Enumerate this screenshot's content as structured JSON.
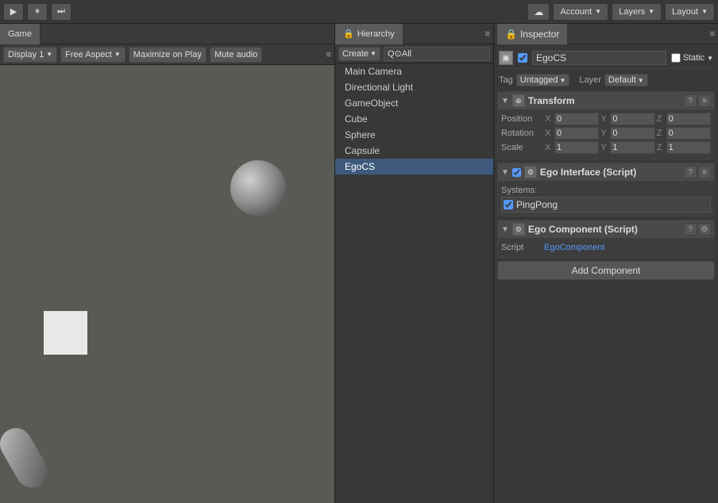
{
  "toolbar": {
    "play_label": "▶",
    "pause_label": "⏸",
    "step_label": "⏭",
    "cloud_icon": "☁",
    "account_label": "Account",
    "layers_label": "Layers",
    "layout_label": "Layout"
  },
  "game_panel": {
    "tab_label": "Game",
    "display_label": "Display 1",
    "aspect_label": "Free Aspect",
    "maximize_label": "Maximize on Play",
    "mute_label": "Mute audio"
  },
  "hierarchy": {
    "tab_label": "Hierarchy",
    "create_label": "Create",
    "search_placeholder": "Q⊙All",
    "items": [
      {
        "label": "Main Camera"
      },
      {
        "label": "Directional Light"
      },
      {
        "label": "GameObject"
      },
      {
        "label": "Cube"
      },
      {
        "label": "Sphere"
      },
      {
        "label": "Capsule"
      },
      {
        "label": "EgoCS",
        "selected": true
      }
    ]
  },
  "inspector": {
    "tab_label": "Inspector",
    "object_name": "EgoCS",
    "static_label": "Static",
    "tag_label": "Tag",
    "tag_value": "Untagged",
    "layer_label": "Layer",
    "layer_value": "Default",
    "transform": {
      "title": "Transform",
      "position_label": "Position",
      "rotation_label": "Rotation",
      "scale_label": "Scale",
      "pos": {
        "x": "0",
        "y": "0",
        "z": "0"
      },
      "rot": {
        "x": "0",
        "y": "0",
        "z": "0"
      },
      "scl": {
        "x": "1",
        "y": "1",
        "z": "1"
      }
    },
    "ego_interface": {
      "title": "Ego Interface (Script)",
      "systems_label": "Systems:",
      "pingpong_label": "PingPong"
    },
    "ego_component": {
      "title": "Ego Component (Script)",
      "script_label": "Script",
      "script_value": "EgoComponent"
    },
    "add_component_label": "Add Component"
  }
}
